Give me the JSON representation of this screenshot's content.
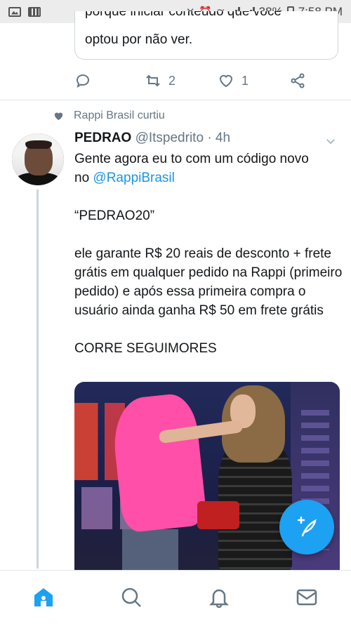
{
  "status_bar": {
    "battery": "38%",
    "time": "7:58 PM"
  },
  "quoted_card": {
    "partial_line": "porque iniciar conteúdo que você",
    "text": "optou por não ver."
  },
  "prev_tweet_actions": {
    "retweet_count": "2",
    "like_count": "1"
  },
  "social_context": "Rappi Brasil curtiu",
  "tweet": {
    "name": "PEDRAO",
    "handle": "@Itspedrito",
    "separator": "·",
    "time": "4h",
    "line1": "Gente agora eu to com um código novo",
    "line2_prefix": "no ",
    "mention": "@RappiBrasil",
    "code": "“PEDRAO20”",
    "para": "ele garante R$ 20 reais de desconto + frete grátis em qualquer pedido na Rappi (primeiro pedido) e após essa primeira compra o usuário ainda ganha R$ 50 em frete grátis",
    "closing": "CORRE SEGUIMORES"
  },
  "colors": {
    "accent": "#1da1f2",
    "secondary_text": "#657786",
    "link": "#1b95e0"
  },
  "icons": {
    "nav": [
      "home-icon",
      "search-icon",
      "notifications-icon",
      "messages-icon"
    ],
    "actions": [
      "reply-icon",
      "retweet-icon",
      "like-icon",
      "share-icon"
    ]
  }
}
